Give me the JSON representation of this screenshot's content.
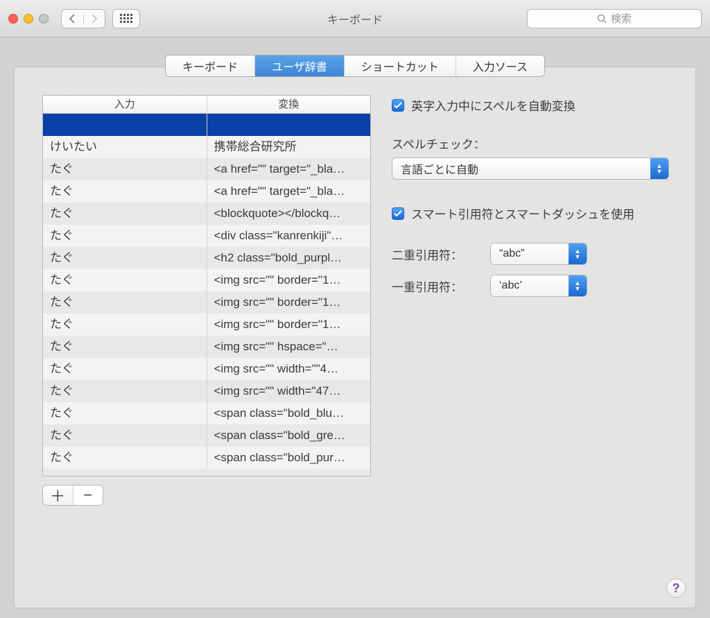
{
  "window": {
    "title": "キーボード"
  },
  "search": {
    "placeholder": "検索"
  },
  "tabs": [
    {
      "label": "キーボード",
      "active": false
    },
    {
      "label": "ユーザ辞書",
      "active": true
    },
    {
      "label": "ショートカット",
      "active": false
    },
    {
      "label": "入力ソース",
      "active": false
    }
  ],
  "table": {
    "headers": {
      "input": "入力",
      "replace": "変換"
    },
    "rows": [
      {
        "in": "",
        "out": "",
        "selected": true
      },
      {
        "in": "けいたい",
        "out": "携帯総合研究所"
      },
      {
        "in": "たぐ",
        "out": "<a href=\"\" target=\"_bla…"
      },
      {
        "in": "たぐ",
        "out": "<a href=\"\" target=\"_bla…"
      },
      {
        "in": "たぐ",
        "out": "<blockquote></blockq…"
      },
      {
        "in": "たぐ",
        "out": "<div class=\"kanrenkiji\"…"
      },
      {
        "in": "たぐ",
        "out": "<h2 class=\"bold_purpl…"
      },
      {
        "in": "たぐ",
        "out": "<img src=\"\" border=\"1…"
      },
      {
        "in": "たぐ",
        "out": "<img src=\"\" border=\"1…"
      },
      {
        "in": "たぐ",
        "out": "<img src=\"\" border=\"1…"
      },
      {
        "in": "たぐ",
        "out": "<img src=\"\" hspace=\"…"
      },
      {
        "in": "たぐ",
        "out": "<img src=\"\" width=\"\"4…"
      },
      {
        "in": "たぐ",
        "out": "<img src=\"\" width=\"47…"
      },
      {
        "in": "たぐ",
        "out": "<span class=\"bold_blu…"
      },
      {
        "in": "たぐ",
        "out": "<span class=\"bold_gre…"
      },
      {
        "in": "たぐ",
        "out": "<span class=\"bold_pur…"
      }
    ]
  },
  "buttons": {
    "add": "＋",
    "remove": "−"
  },
  "right": {
    "auto_spell_label": "英字入力中にスペルを自動変換",
    "spell_check_label": "スペルチェック：",
    "spell_check_value": "言語ごとに自動",
    "smart_quotes_label": "スマート引用符とスマートダッシュを使用",
    "double_quote_label": "二重引用符：",
    "double_quote_value": "“abc”",
    "single_quote_label": "一重引用符：",
    "single_quote_value": "‘abc’"
  },
  "help": {
    "label": "?"
  }
}
